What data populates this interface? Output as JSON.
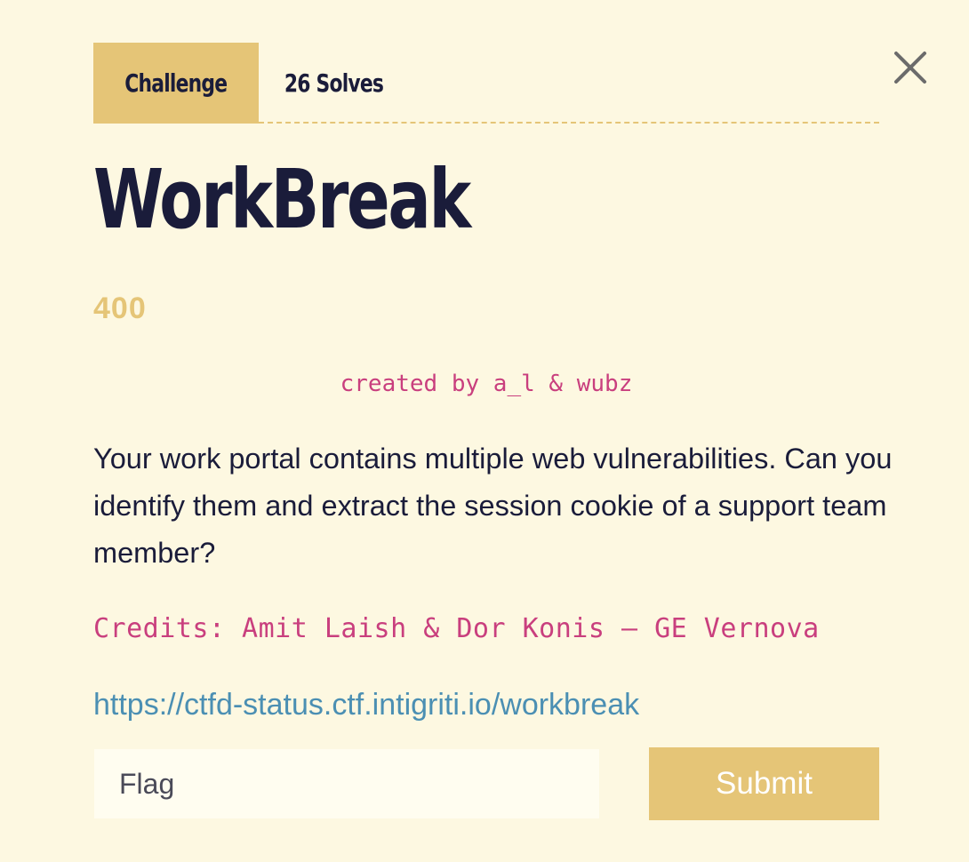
{
  "tabs": {
    "challenge_label": "Challenge",
    "solves_label": "26 Solves"
  },
  "close": {
    "icon": "close-icon"
  },
  "challenge": {
    "title": "WorkBreak",
    "points": "400",
    "author": "created by a_l & wubz",
    "description": "Your work portal contains multiple web vulnerabilities. Can you identify them and extract the session cookie of a support team member?",
    "credits": "Credits: Amit Laish & Dor Konis – GE Vernova",
    "link": "https://ctfd-status.ctf.intigriti.io/workbreak"
  },
  "form": {
    "flag_placeholder": "Flag",
    "flag_value": "",
    "submit_label": "Submit"
  },
  "colors": {
    "background": "#fdf8e1",
    "accent": "#e5c577",
    "text": "#1a1c3a",
    "pink": "#c93f7e",
    "link": "#4b8fb3"
  }
}
